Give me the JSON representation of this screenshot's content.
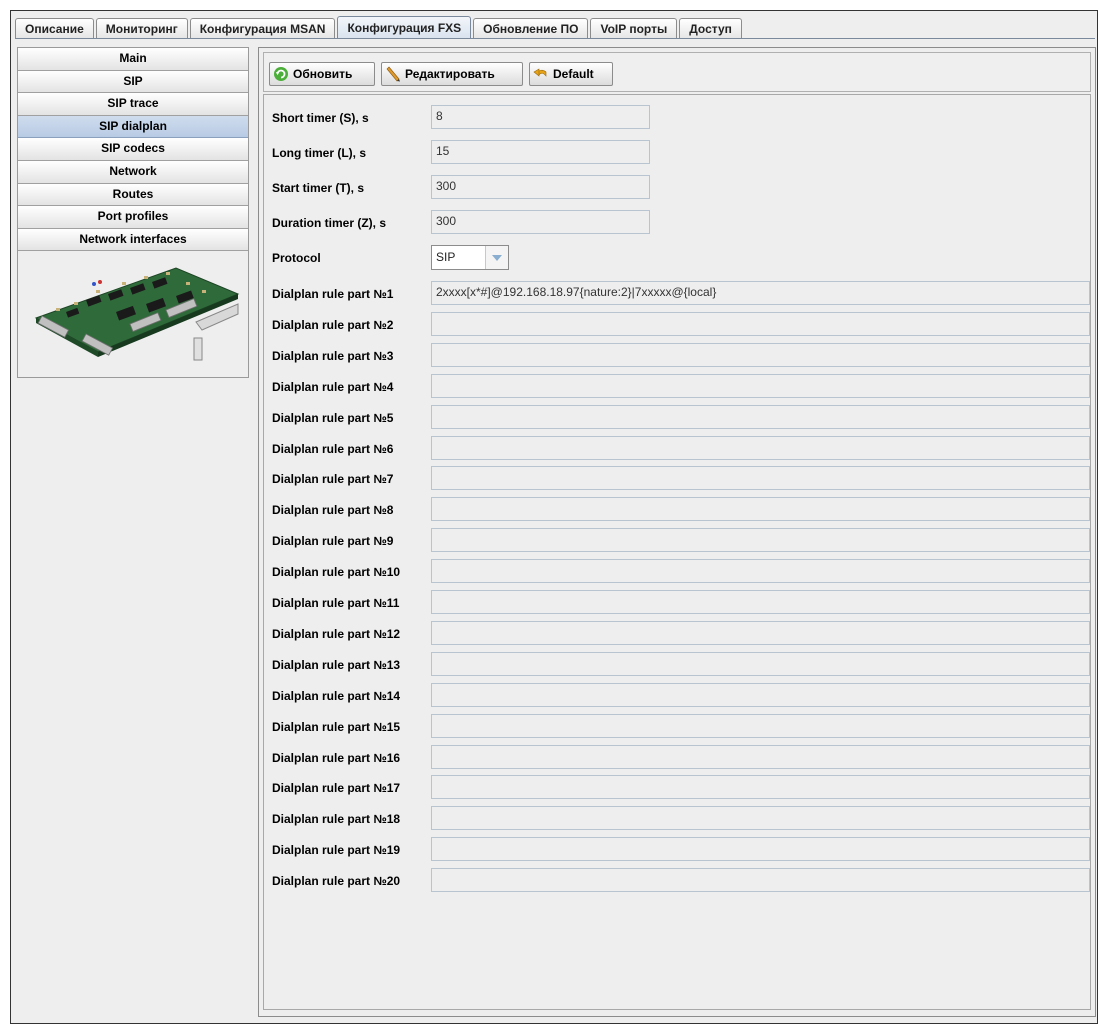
{
  "tabs": [
    {
      "label": "Описание"
    },
    {
      "label": "Мониторинг"
    },
    {
      "label": "Конфигурация MSAN"
    },
    {
      "label": "Конфигурация FXS",
      "active": true
    },
    {
      "label": "Обновление ПО"
    },
    {
      "label": "VoIP порты"
    },
    {
      "label": "Доступ"
    }
  ],
  "sidebar": {
    "items": [
      {
        "label": "Main"
      },
      {
        "label": "SIP"
      },
      {
        "label": "SIP trace"
      },
      {
        "label": "SIP dialplan",
        "active": true
      },
      {
        "label": "SIP codecs"
      },
      {
        "label": "Network"
      },
      {
        "label": "Routes"
      },
      {
        "label": "Port profiles"
      },
      {
        "label": "Network interfaces"
      }
    ],
    "image_icon": "circuit-board-image"
  },
  "toolbar": {
    "refresh_label": "Обновить",
    "edit_label": "Редактировать",
    "default_label": "Default"
  },
  "form": {
    "short_timer": {
      "label": "Short timer (S), s",
      "value": "8"
    },
    "long_timer": {
      "label": "Long timer (L), s",
      "value": "15"
    },
    "start_timer": {
      "label": "Start timer (T), s",
      "value": "300"
    },
    "duration_timer": {
      "label": "Duration timer (Z), s",
      "value": "300"
    },
    "protocol": {
      "label": "Protocol",
      "value": "SIP"
    },
    "rules": [
      {
        "label": "Dialplan rule part №1",
        "value": "2xxxx[x*#]@192.168.18.97{nature:2}|7xxxxx@{local}"
      },
      {
        "label": "Dialplan rule part №2",
        "value": ""
      },
      {
        "label": "Dialplan rule part №3",
        "value": ""
      },
      {
        "label": "Dialplan rule part №4",
        "value": ""
      },
      {
        "label": "Dialplan rule part №5",
        "value": ""
      },
      {
        "label": "Dialplan rule part №6",
        "value": ""
      },
      {
        "label": "Dialplan rule part №7",
        "value": ""
      },
      {
        "label": "Dialplan rule part №8",
        "value": ""
      },
      {
        "label": "Dialplan rule part №9",
        "value": ""
      },
      {
        "label": "Dialplan rule part №10",
        "value": ""
      },
      {
        "label": "Dialplan rule part №11",
        "value": ""
      },
      {
        "label": "Dialplan rule part №12",
        "value": ""
      },
      {
        "label": "Dialplan rule part №13",
        "value": ""
      },
      {
        "label": "Dialplan rule part №14",
        "value": ""
      },
      {
        "label": "Dialplan rule part №15",
        "value": ""
      },
      {
        "label": "Dialplan rule part №16",
        "value": ""
      },
      {
        "label": "Dialplan rule part №17",
        "value": ""
      },
      {
        "label": "Dialplan rule part №18",
        "value": ""
      },
      {
        "label": "Dialplan rule part №19",
        "value": ""
      },
      {
        "label": "Dialplan rule part №20",
        "value": ""
      }
    ]
  },
  "colors": {
    "active_tab": "#d9e3ee",
    "active_nav": "#b8cbe4",
    "field_border": "#b8c4cf"
  }
}
